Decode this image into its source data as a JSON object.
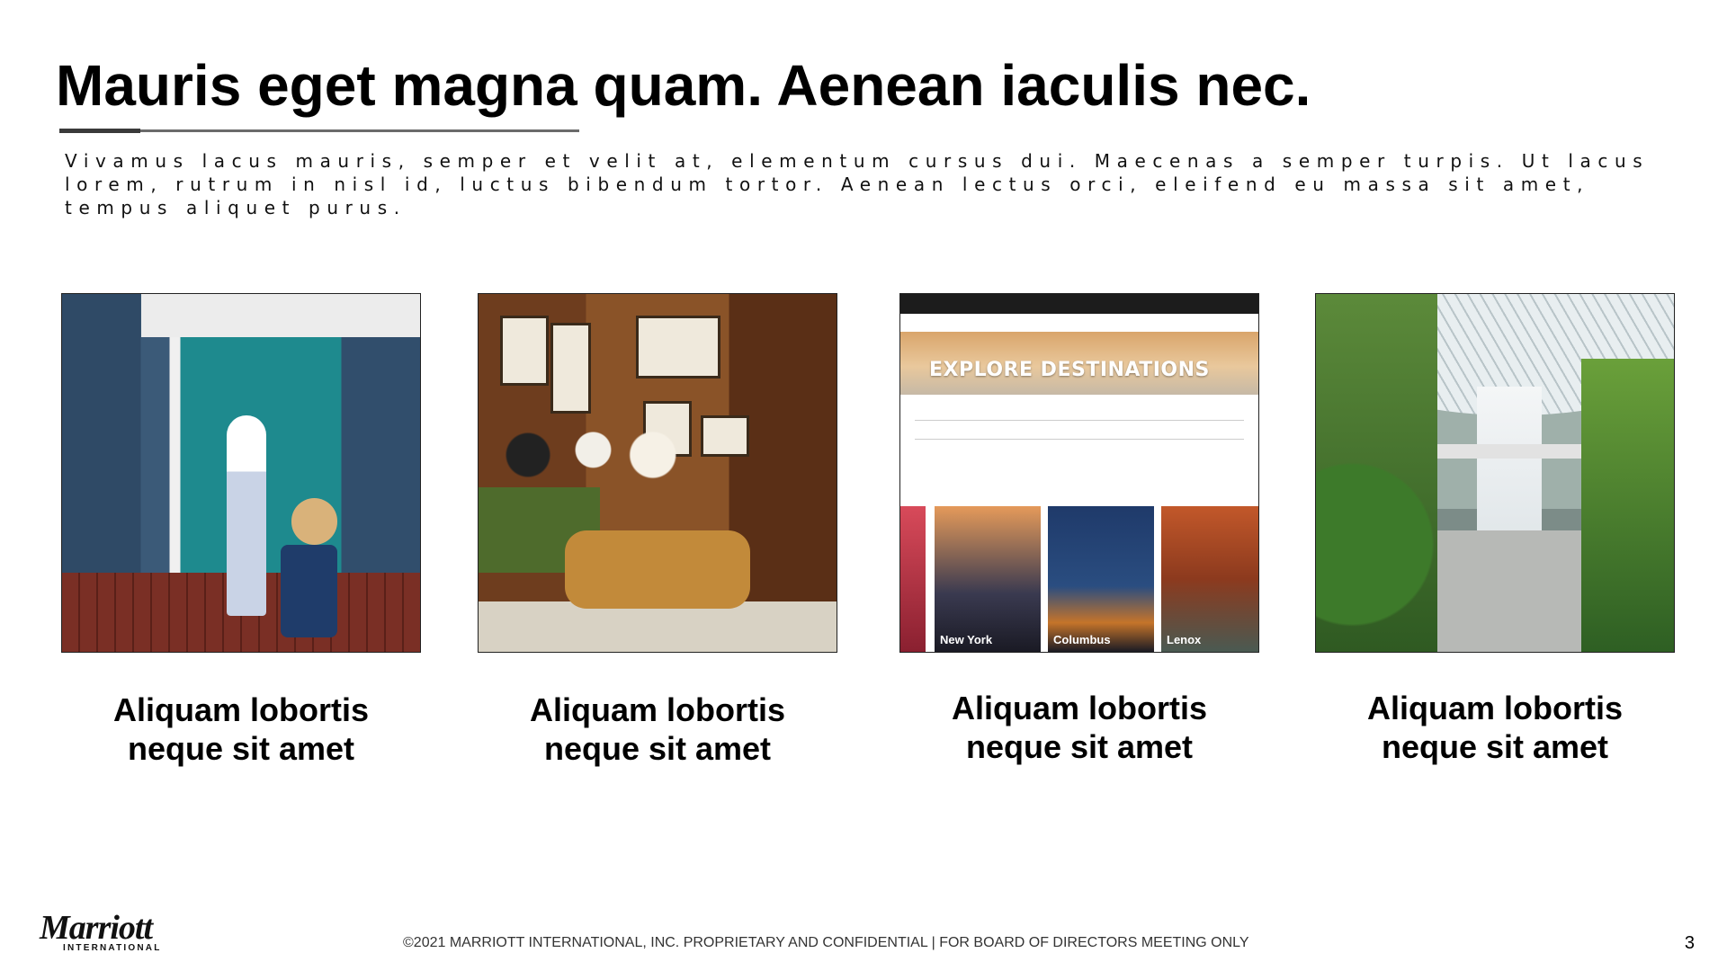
{
  "slide": {
    "title": "Mauris eget magna quam. Aenean iaculis nec.",
    "subtitle": "Vivamus lacus mauris, semper et velit at, elementum cursus dui. Maecenas a semper turpis. Ut lacus lorem, rutrum in nisl id, luctus bibendum tortor. Aenean lectus orci, eleifend eu massa sit amet, tempus aliquet purus."
  },
  "cards": [
    {
      "line1": "Aliquam lobortis",
      "line2": "neque sit amet",
      "image": "woman-at-doorway-photo"
    },
    {
      "line1": "Aliquam lobortis",
      "line2": "neque sit amet",
      "image": "hotel-lounge-photo"
    },
    {
      "line1": "Aliquam lobortis",
      "line2": "neque sit amet",
      "image": "explore-destinations-website-screenshot"
    },
    {
      "line1": "Aliquam lobortis",
      "line2": "neque sit amet",
      "image": "indoor-waterfall-photo"
    }
  ],
  "website": {
    "hero": "EXPLORE DESTINATIONS",
    "cities": [
      "New York",
      "Columbus",
      "Lenox"
    ]
  },
  "footer": {
    "logo_word": "Marriott",
    "logo_sub": "INTERNATIONAL",
    "confidential": "©2021 MARRIOTT INTERNATIONAL, INC. PROPRIETARY AND CONFIDENTIAL | FOR BOARD OF DIRECTORS MEETING ONLY",
    "page_number": "3"
  }
}
